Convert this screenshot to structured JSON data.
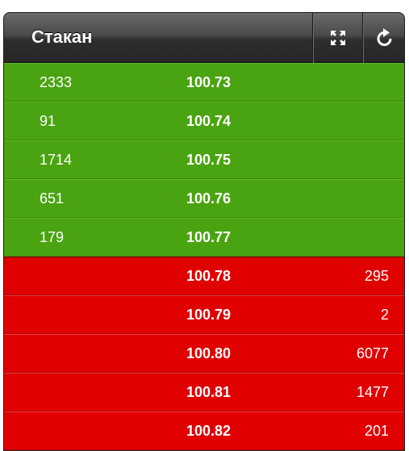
{
  "header": {
    "title": "Стакан",
    "buttons": [
      {
        "icon": "expand-icon"
      },
      {
        "icon": "refresh-icon"
      }
    ]
  },
  "colors": {
    "bid_background": "#4aa310",
    "ask_background": "#e00000",
    "header_background": "#3a3a3a",
    "text": "#ffffff"
  },
  "order_book": {
    "rows": [
      {
        "side": "bid",
        "bid_volume": "2333",
        "price": "100.73",
        "ask_volume": ""
      },
      {
        "side": "bid",
        "bid_volume": "91",
        "price": "100.74",
        "ask_volume": ""
      },
      {
        "side": "bid",
        "bid_volume": "1714",
        "price": "100.75",
        "ask_volume": ""
      },
      {
        "side": "bid",
        "bid_volume": "651",
        "price": "100.76",
        "ask_volume": ""
      },
      {
        "side": "bid",
        "bid_volume": "179",
        "price": "100.77",
        "ask_volume": ""
      },
      {
        "side": "ask",
        "bid_volume": "",
        "price": "100.78",
        "ask_volume": "295"
      },
      {
        "side": "ask",
        "bid_volume": "",
        "price": "100.79",
        "ask_volume": "2"
      },
      {
        "side": "ask",
        "bid_volume": "",
        "price": "100.80",
        "ask_volume": "6077"
      },
      {
        "side": "ask",
        "bid_volume": "",
        "price": "100.81",
        "ask_volume": "1477"
      },
      {
        "side": "ask",
        "bid_volume": "",
        "price": "100.82",
        "ask_volume": "201"
      }
    ]
  }
}
